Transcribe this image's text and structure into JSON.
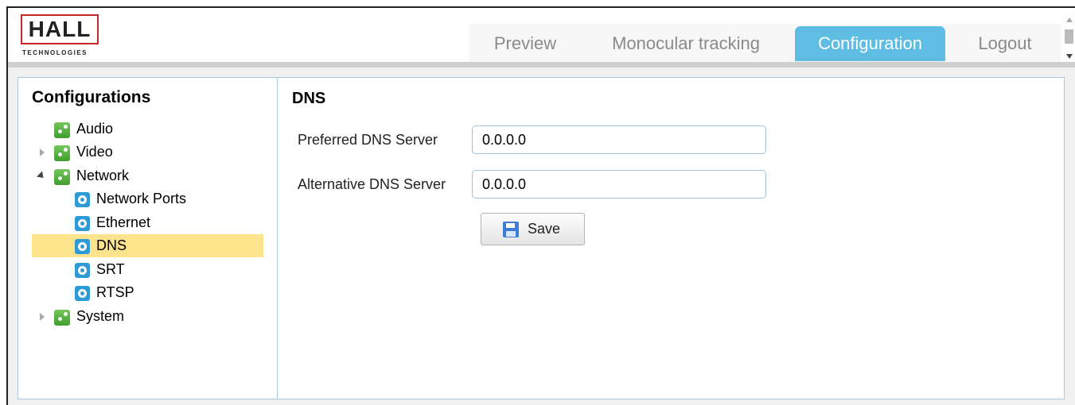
{
  "logo": {
    "name": "HALL",
    "subtitle": "TECHNOLOGIES"
  },
  "tabs": [
    {
      "label": "Preview",
      "active": false
    },
    {
      "label": "Monocular tracking",
      "active": false
    },
    {
      "label": "Configuration",
      "active": true
    },
    {
      "label": "Logout",
      "active": false
    }
  ],
  "sidebar": {
    "title": "Configurations",
    "items": [
      {
        "label": "Audio",
        "icon": "gear-icon",
        "expander": "none"
      },
      {
        "label": "Video",
        "icon": "gear-icon",
        "expander": "collapsed"
      },
      {
        "label": "Network",
        "icon": "gear-icon",
        "expander": "expanded"
      },
      {
        "label": "Network Ports",
        "icon": "cog-icon"
      },
      {
        "label": "Ethernet",
        "icon": "cog-icon"
      },
      {
        "label": "DNS",
        "icon": "cog-icon",
        "selected": true
      },
      {
        "label": "SRT",
        "icon": "cog-icon"
      },
      {
        "label": "RTSP",
        "icon": "cog-icon"
      },
      {
        "label": "System",
        "icon": "gear-icon",
        "expander": "collapsed"
      }
    ]
  },
  "main": {
    "title": "DNS",
    "preferred_label": "Preferred DNS Server",
    "preferred_value": "0.0.0.0",
    "alternative_label": "Alternative DNS Server",
    "alternative_value": "0.0.0.0",
    "save_label": "Save"
  },
  "colors": {
    "active_tab": "#5fbde3",
    "selected_item": "#fde38c",
    "panel_border": "#a8c8e8",
    "logo_border": "#c62828"
  }
}
